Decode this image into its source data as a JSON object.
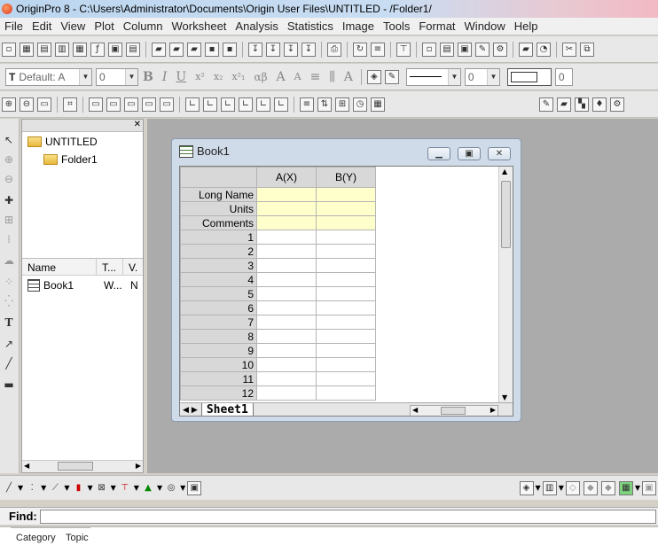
{
  "window": {
    "title": "OriginPro 8 - C:\\Users\\Administrator\\Documents\\Origin User Files\\UNTITLED - /Folder1/"
  },
  "menu": [
    "File",
    "Edit",
    "View",
    "Plot",
    "Column",
    "Worksheet",
    "Analysis",
    "Statistics",
    "Image",
    "Tools",
    "Format",
    "Window",
    "Help"
  ],
  "format_toolbar": {
    "font_name": "Default: A",
    "font_size": "0",
    "line_width": "0",
    "border_size": "0"
  },
  "explorer": {
    "root_folder": "UNTITLED",
    "sub_folder": "Folder1",
    "columns": [
      "Name",
      "T...",
      "V."
    ],
    "items": [
      {
        "name": "Book1",
        "type": "W...",
        "view": "N"
      }
    ]
  },
  "book": {
    "title": "Book1",
    "columns": [
      "A(X)",
      "B(Y)"
    ],
    "meta_rows": [
      "Long Name",
      "Units",
      "Comments"
    ],
    "rows": [
      "1",
      "2",
      "3",
      "4",
      "5",
      "6",
      "7",
      "8",
      "9",
      "10",
      "11",
      "12"
    ],
    "sheet_tab": "Sheet1"
  },
  "find": {
    "label": "Find:",
    "value": ""
  },
  "help_tabs": [
    "Category",
    "Topic"
  ],
  "icons": [
    "pointer-icon",
    "zoom-in-icon",
    "zoom-out-icon",
    "text-tool-icon",
    "arrow-tool-icon",
    "line-tool-icon",
    "rectangle-tool-icon"
  ]
}
